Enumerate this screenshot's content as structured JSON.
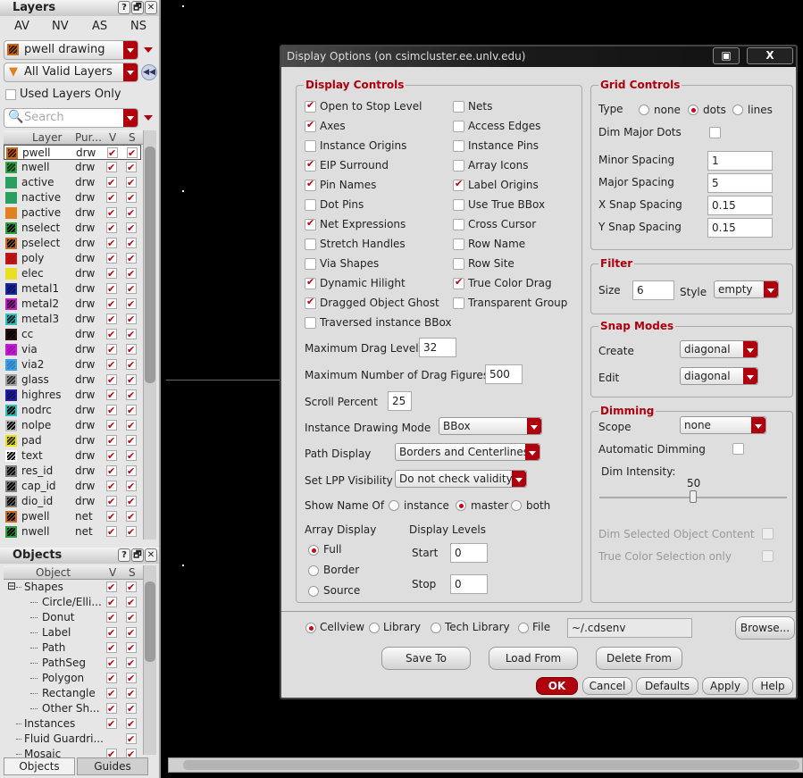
{
  "layers_panel": {
    "title": "Layers",
    "title_buttons": [
      "?",
      "🗗",
      "✕"
    ],
    "visibility_tabs": [
      "AV",
      "NV",
      "AS",
      "NS"
    ],
    "current_layer": "pwell drawing",
    "filter": "All Valid Layers",
    "used_layers_only": "Used Layers Only",
    "search_placeholder": "Search",
    "columns": [
      "Layer",
      "Pur...",
      "V",
      "S"
    ],
    "rows": [
      {
        "name": "pwell",
        "purpose": "drw",
        "color": "#c86a1e",
        "fill": "#3a1a08"
      },
      {
        "name": "nwell",
        "purpose": "drw",
        "color": "#3aa04a",
        "fill": "#123a18"
      },
      {
        "name": "active",
        "purpose": "drw",
        "color": "#2aa060",
        "fill": "#2aa060"
      },
      {
        "name": "nactive",
        "purpose": "drw",
        "color": "#2aa060",
        "fill": "#2aa060"
      },
      {
        "name": "pactive",
        "purpose": "drw",
        "color": "#e08020",
        "fill": "#e08020"
      },
      {
        "name": "nselect",
        "purpose": "drw",
        "color": "#2aa040",
        "fill": "#000000"
      },
      {
        "name": "pselect",
        "purpose": "drw",
        "color": "#c86a1e",
        "fill": "#000000"
      },
      {
        "name": "poly",
        "purpose": "drw",
        "color": "#c01818",
        "fill": "#b01010"
      },
      {
        "name": "elec",
        "purpose": "drw",
        "color": "#e8e020",
        "fill": "#e8e020"
      },
      {
        "name": "metal1",
        "purpose": "drw",
        "color": "#1a2a9a",
        "fill": "#0a1060"
      },
      {
        "name": "metal2",
        "purpose": "drw",
        "color": "#c020c0",
        "fill": "#300030"
      },
      {
        "name": "metal3",
        "purpose": "drw",
        "color": "#30c0c0",
        "fill": "#002020"
      },
      {
        "name": "cc",
        "purpose": "drw",
        "color": "#301010",
        "fill": "#000000"
      },
      {
        "name": "via",
        "purpose": "drw",
        "color": "#c020d0",
        "fill": "#a010b0"
      },
      {
        "name": "via2",
        "purpose": "drw",
        "color": "#40a0e0",
        "fill": "#3080c0"
      },
      {
        "name": "glass",
        "purpose": "drw",
        "color": "#a0a0a0",
        "fill": "#303030"
      },
      {
        "name": "highres",
        "purpose": "drw",
        "color": "#2020a0",
        "fill": "#101060"
      },
      {
        "name": "nodrc",
        "purpose": "drw",
        "color": "#30c0c0",
        "fill": "#000000"
      },
      {
        "name": "nolpe",
        "purpose": "drw",
        "color": "#c0c0c0",
        "fill": "#000000"
      },
      {
        "name": "pad",
        "purpose": "drw",
        "color": "#e8e020",
        "fill": "#303000"
      },
      {
        "name": "text",
        "purpose": "drw",
        "color": "#ffffff",
        "fill": "#000000"
      },
      {
        "name": "res_id",
        "purpose": "drw",
        "color": "#808080",
        "fill": "#000000"
      },
      {
        "name": "cap_id",
        "purpose": "drw",
        "color": "#808080",
        "fill": "#000000"
      },
      {
        "name": "dio_id",
        "purpose": "drw",
        "color": "#808080",
        "fill": "#000000"
      },
      {
        "name": "pwell",
        "purpose": "net",
        "color": "#c86a1e",
        "fill": "#000000"
      },
      {
        "name": "nwell",
        "purpose": "net",
        "color": "#2aa040",
        "fill": "#000000"
      }
    ]
  },
  "objects_panel": {
    "title": "Objects",
    "columns": [
      "Object",
      "V",
      "S"
    ],
    "rows": [
      {
        "name": "Shapes",
        "level": 0,
        "expand": "⊟",
        "v": true,
        "s": true
      },
      {
        "name": "Circle/Elli...",
        "level": 1,
        "v": true,
        "s": true
      },
      {
        "name": "Donut",
        "level": 1,
        "v": true,
        "s": true
      },
      {
        "name": "Label",
        "level": 1,
        "v": true,
        "s": true
      },
      {
        "name": "Path",
        "level": 1,
        "v": true,
        "s": true
      },
      {
        "name": "PathSeg",
        "level": 1,
        "v": true,
        "s": true
      },
      {
        "name": "Polygon",
        "level": 1,
        "v": true,
        "s": true
      },
      {
        "name": "Rectangle",
        "level": 1,
        "v": true,
        "s": true
      },
      {
        "name": "Other Sh...",
        "level": 1,
        "v": true,
        "s": true
      },
      {
        "name": "Instances",
        "level": 0,
        "v": true,
        "s": true
      },
      {
        "name": "Fluid Guardri...",
        "level": 0,
        "v": false,
        "s": true
      },
      {
        "name": "Mosaic",
        "level": 0,
        "v": true,
        "s": true
      }
    ],
    "tabs": [
      "Objects",
      "Guides"
    ]
  },
  "dialog": {
    "title": "Display Options (on csimcluster.ee.unlv.edu)",
    "close": "X",
    "display_controls": {
      "title": "Display Controls",
      "left": [
        {
          "label": "Open to Stop Level",
          "on": true
        },
        {
          "label": "Axes",
          "on": true
        },
        {
          "label": "Instance Origins",
          "on": false
        },
        {
          "label": "EIP Surround",
          "on": true
        },
        {
          "label": "Pin Names",
          "on": true
        },
        {
          "label": "Dot Pins",
          "on": false
        },
        {
          "label": "Net Expressions",
          "on": true
        },
        {
          "label": "Stretch Handles",
          "on": false
        },
        {
          "label": "Via Shapes",
          "on": false
        },
        {
          "label": "Dynamic Hilight",
          "on": true
        },
        {
          "label": "Dragged Object Ghost",
          "on": true
        },
        {
          "label": "Traversed instance BBox",
          "on": false
        }
      ],
      "right": [
        {
          "label": "Nets",
          "on": false
        },
        {
          "label": "Access Edges",
          "on": false
        },
        {
          "label": "Instance Pins",
          "on": false
        },
        {
          "label": "Array Icons",
          "on": false
        },
        {
          "label": "Label Origins",
          "on": true
        },
        {
          "label": "Use True BBox",
          "on": false
        },
        {
          "label": "Cross Cursor",
          "on": false
        },
        {
          "label": "Row Name",
          "on": false
        },
        {
          "label": "Row Site",
          "on": false
        },
        {
          "label": "True Color Drag",
          "on": true
        },
        {
          "label": "Transparent Group",
          "on": false
        }
      ],
      "max_drag_level_label": "Maximum Drag Level",
      "max_drag_level": "32",
      "max_drag_figures_label": "Maximum Number of Drag Figures",
      "max_drag_figures": "500",
      "scroll_percent_label": "Scroll Percent",
      "scroll_percent": "25",
      "instance_drawing_mode_label": "Instance Drawing Mode",
      "instance_drawing_mode": "BBox",
      "path_display_label": "Path Display",
      "path_display": "Borders and Centerlines",
      "lpp_visibility_label": "Set LPP Visibility",
      "lpp_visibility": "Do not check validity",
      "show_name_of_label": "Show Name Of",
      "show_name_of": [
        {
          "label": "instance",
          "on": false
        },
        {
          "label": "master",
          "on": true
        },
        {
          "label": "both",
          "on": false
        }
      ],
      "array_display_label": "Array Display",
      "array_display": [
        {
          "label": "Full",
          "on": true
        },
        {
          "label": "Border",
          "on": false
        },
        {
          "label": "Source",
          "on": false
        }
      ],
      "display_levels_label": "Display Levels",
      "start_label": "Start",
      "start": "0",
      "stop_label": "Stop",
      "stop": "0"
    },
    "grid_controls": {
      "title": "Grid Controls",
      "type_label": "Type",
      "types": [
        {
          "label": "none",
          "on": false
        },
        {
          "label": "dots",
          "on": true
        },
        {
          "label": "lines",
          "on": false
        }
      ],
      "dim_major_dots_label": "Dim Major Dots",
      "dim_major_dots": false,
      "minor_spacing_label": "Minor Spacing",
      "minor_spacing": "1",
      "major_spacing_label": "Major Spacing",
      "major_spacing": "5",
      "x_snap_label": "X Snap Spacing",
      "x_snap": "0.15",
      "y_snap_label": "Y Snap Spacing",
      "y_snap": "0.15"
    },
    "filter": {
      "title": "Filter",
      "size_label": "Size",
      "size": "6",
      "style_label": "Style",
      "style": "empty"
    },
    "snap_modes": {
      "title": "Snap Modes",
      "create_label": "Create",
      "create": "diagonal",
      "edit_label": "Edit",
      "edit": "diagonal"
    },
    "dimming": {
      "title": "Dimming",
      "scope_label": "Scope",
      "scope": "none",
      "auto_label": "Automatic Dimming",
      "auto": false,
      "intensity_label": "Dim Intensity:",
      "intensity": 50,
      "intensity_text": "50",
      "dim_selected_label": "Dim Selected Object Content",
      "true_color_label": "True Color Selection only"
    },
    "save_target": [
      {
        "label": "Cellview",
        "on": true
      },
      {
        "label": "Library",
        "on": false
      },
      {
        "label": "Tech Library",
        "on": false
      },
      {
        "label": "File",
        "on": false
      }
    ],
    "file_path": "~/.cdsenv",
    "browse": "Browse...",
    "save_to": "Save To",
    "load_from": "Load From",
    "delete_from": "Delete From",
    "ok": "OK",
    "cancel": "Cancel",
    "defaults": "Defaults",
    "apply": "Apply",
    "help": "Help"
  },
  "colors": {
    "accent": "#b0000e",
    "canvas": "#000000"
  }
}
